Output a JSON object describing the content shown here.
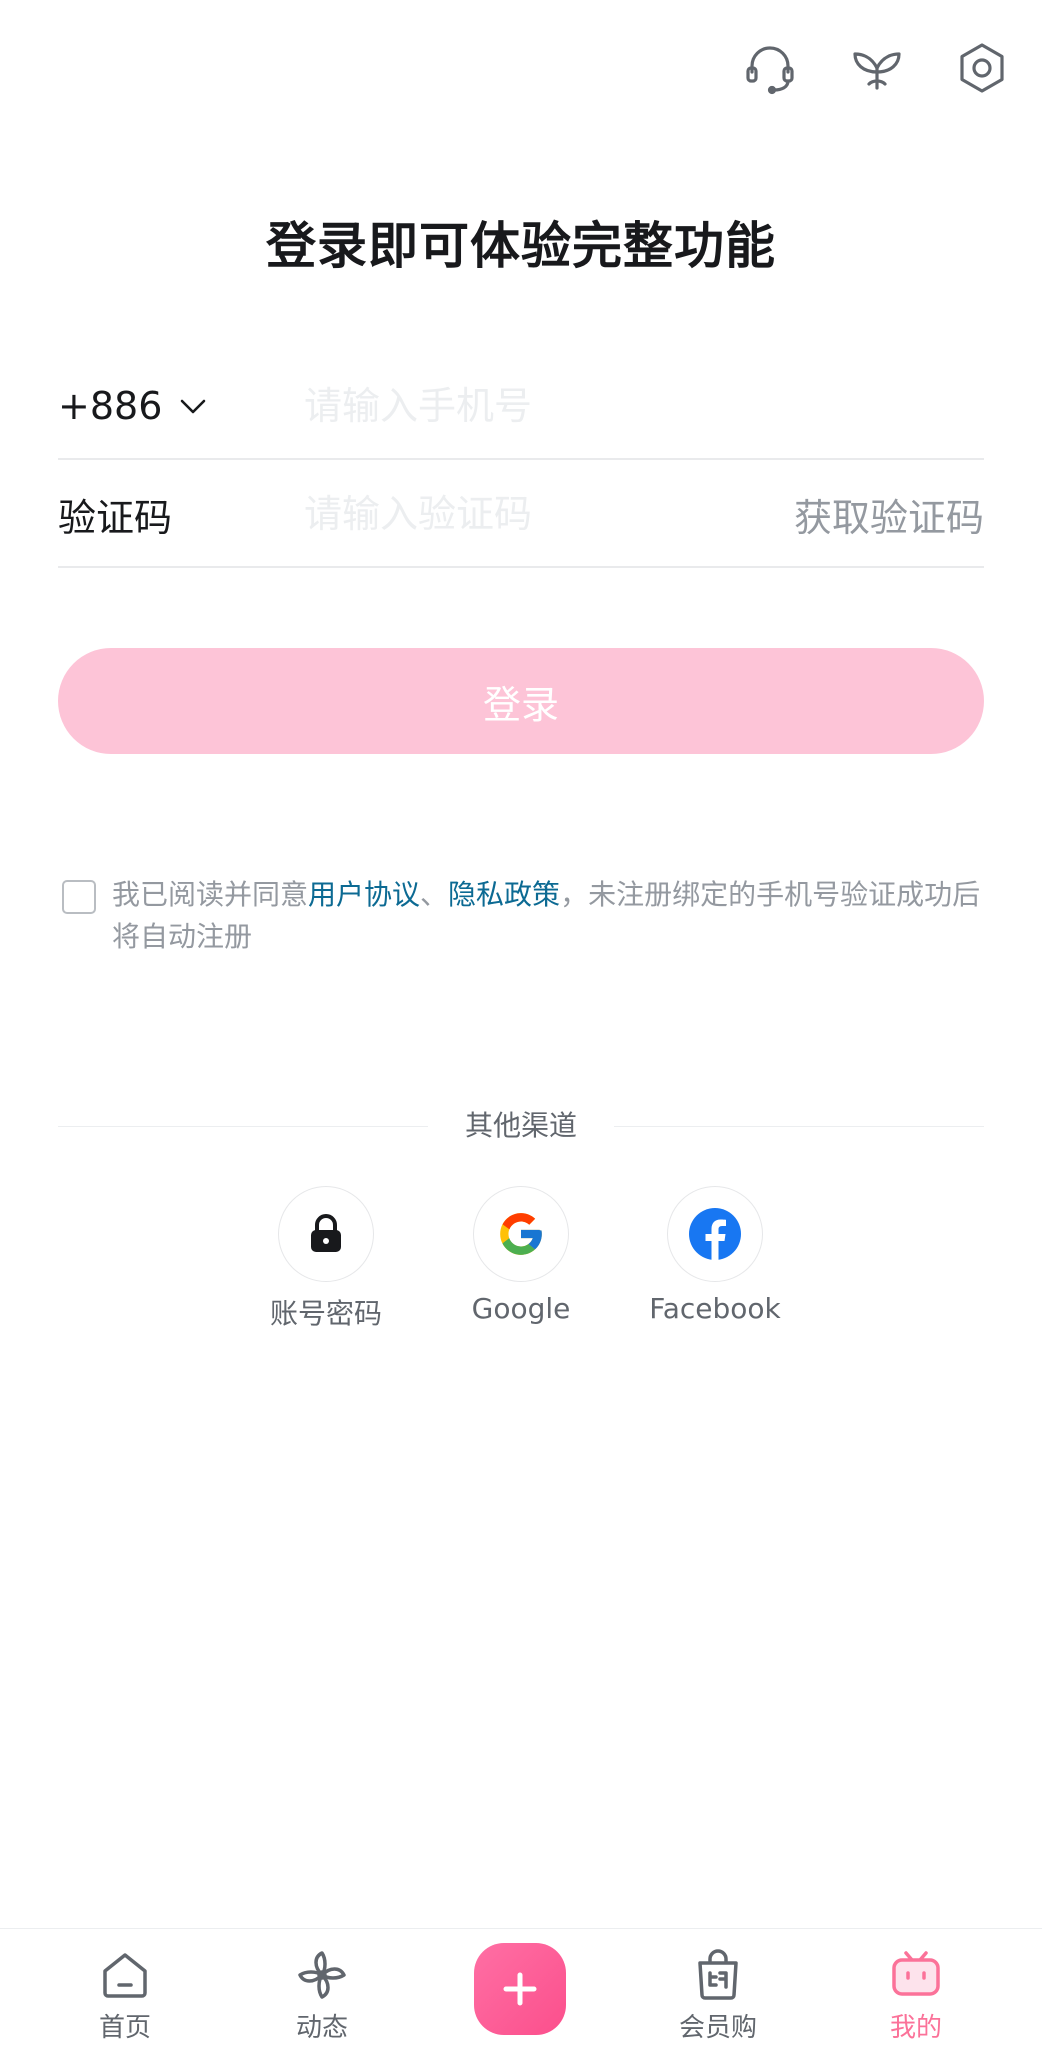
{
  "header": {
    "icons": [
      "headset-icon",
      "sprout-icon",
      "settings-icon"
    ]
  },
  "title": "登录即可体验完整功能",
  "phone": {
    "country_code": "+886",
    "placeholder": "请输入手机号"
  },
  "code": {
    "label": "验证码",
    "placeholder": "请输入验证码",
    "get_code": "获取验证码"
  },
  "login_button": "登录",
  "agreement": {
    "prefix": "我已阅读并同意",
    "user_agreement": "用户协议",
    "separator": "、",
    "privacy_policy": "隐私政策",
    "suffix": "，未注册绑定的手机号验证成功后将自动注册"
  },
  "other_channels": {
    "title": "其他渠道",
    "items": [
      {
        "label": "账号密码",
        "icon": "lock-icon"
      },
      {
        "label": "Google",
        "icon": "google-icon"
      },
      {
        "label": "Facebook",
        "icon": "facebook-icon"
      }
    ]
  },
  "bottom_nav": {
    "items": [
      {
        "label": "首页",
        "icon": "home-icon"
      },
      {
        "label": "动态",
        "icon": "pinwheel-icon"
      },
      {
        "label": "",
        "icon": "plus-icon"
      },
      {
        "label": "会员购",
        "icon": "shopping-bag-icon"
      },
      {
        "label": "我的",
        "icon": "tv-icon",
        "active": true
      }
    ]
  },
  "colors": {
    "accent": "#fb7299",
    "login_button_disabled": "#fdc4d7",
    "link": "#0c6a93"
  }
}
